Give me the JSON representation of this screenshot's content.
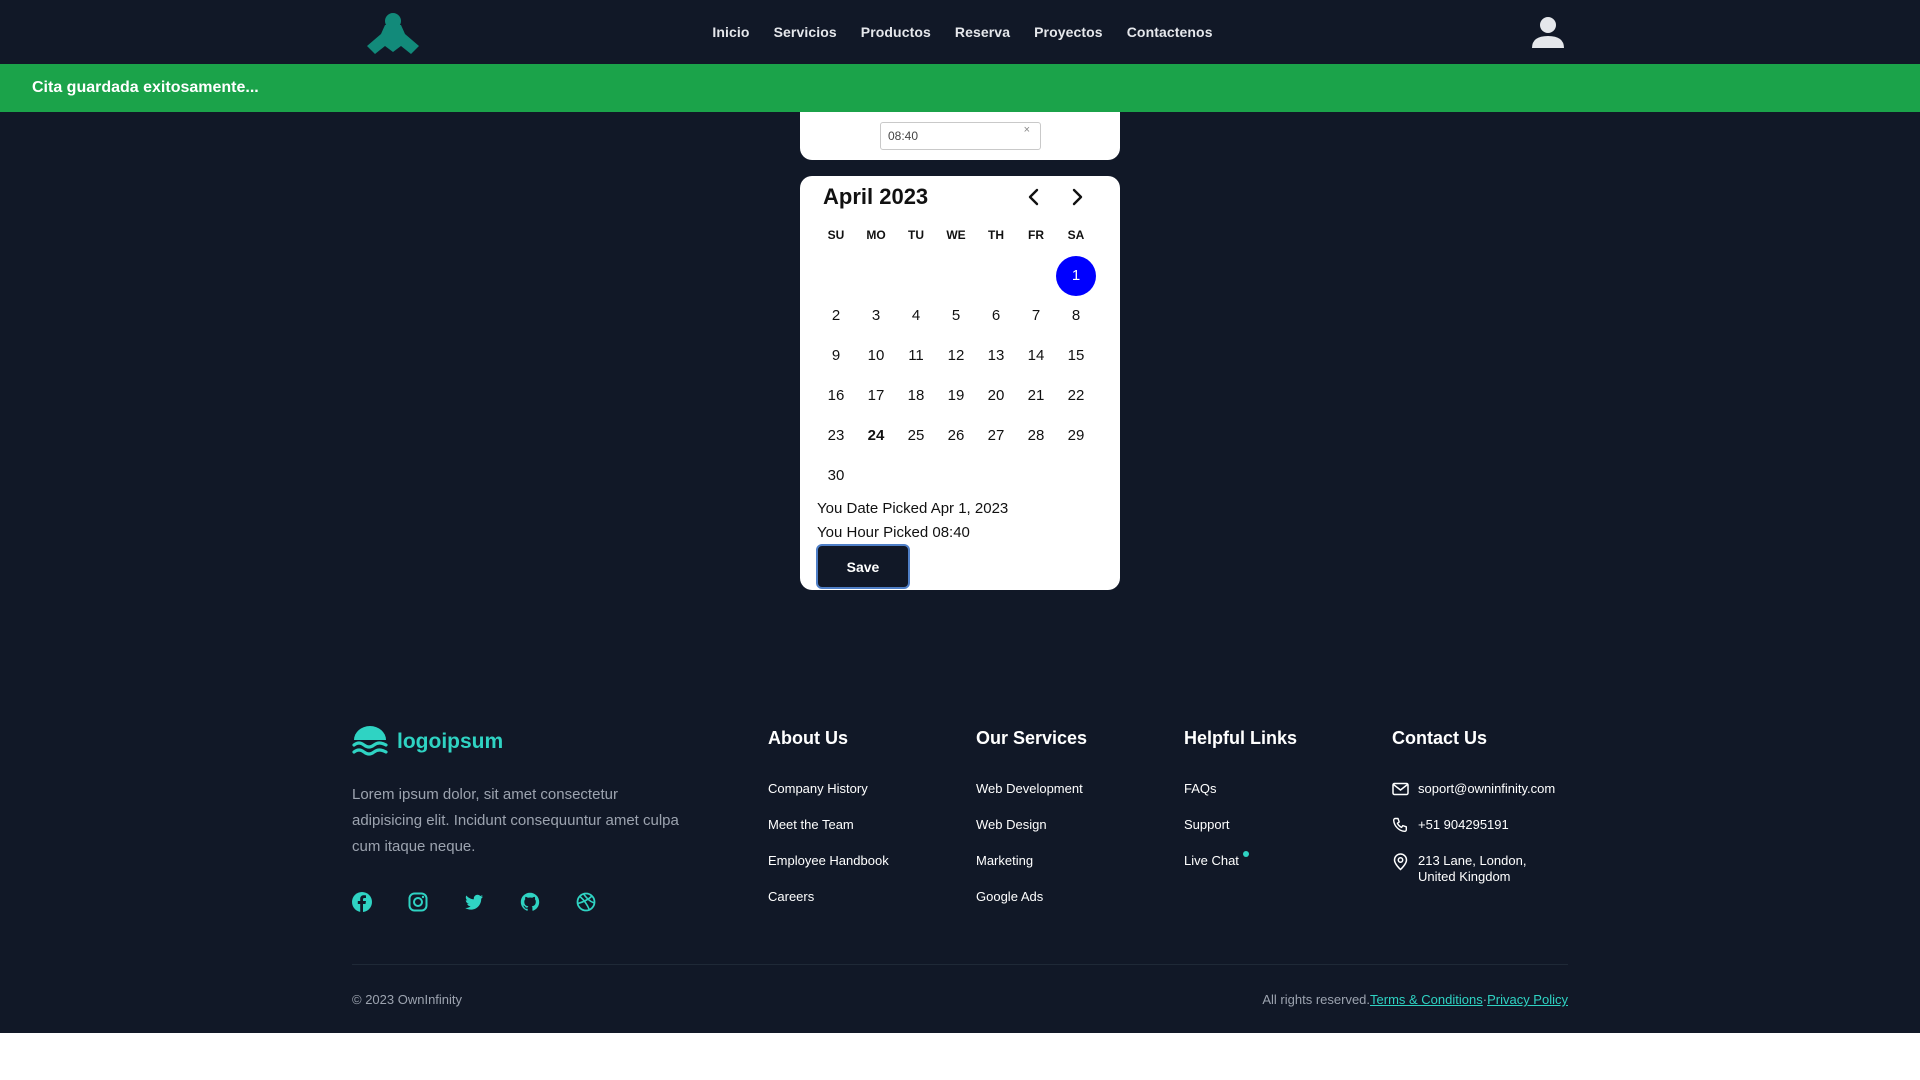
{
  "header": {
    "nav": [
      "Inicio",
      "Servicios",
      "Productos",
      "Reserva",
      "Proyectos",
      "Contactenos"
    ]
  },
  "toast": {
    "message": "Cita guardada exitosamente..."
  },
  "time_picker": {
    "value": "08:40",
    "clear_symbol": "×"
  },
  "calendar": {
    "month_label": "April 2023",
    "weekdays": [
      "SU",
      "MO",
      "TU",
      "WE",
      "TH",
      "FR",
      "SA"
    ],
    "days": [
      "1",
      "2",
      "3",
      "4",
      "5",
      "6",
      "7",
      "8",
      "9",
      "10",
      "11",
      "12",
      "13",
      "14",
      "15",
      "16",
      "17",
      "18",
      "19",
      "20",
      "21",
      "22",
      "23",
      "24",
      "25",
      "26",
      "27",
      "28",
      "29",
      "30"
    ],
    "selected_day": "1",
    "today_day": "24",
    "picked_date_text": "You Date Picked Apr 1, 2023",
    "picked_hour_text": "You Hour Picked 08:40",
    "save_label": "Save"
  },
  "footer": {
    "logo_text": "logoipsum",
    "description": "Lorem ipsum dolor, sit amet consectetur adipisicing elit. Incidunt consequuntur amet culpa cum itaque neque.",
    "socials": [
      "facebook-icon",
      "instagram-icon",
      "twitter-icon",
      "github-icon",
      "dribbble-icon"
    ],
    "about": {
      "title": "About Us",
      "links": [
        "Company History",
        "Meet the Team",
        "Employee Handbook",
        "Careers"
      ]
    },
    "services": {
      "title": "Our Services",
      "links": [
        "Web Development",
        "Web Design",
        "Marketing",
        "Google Ads"
      ]
    },
    "helpful": {
      "title": "Helpful Links",
      "links": [
        "FAQs",
        "Support",
        "Live Chat"
      ]
    },
    "contact": {
      "title": "Contact Us",
      "email": "soport@owninfinity.com",
      "phone": "+51 904295191",
      "address_line1": "213 Lane, London,",
      "address_line2": "United Kingdom"
    },
    "copyright": "© 2023 OwnInfinity",
    "rights": "All rights reserved.",
    "terms": "Terms & Conditions",
    "separator": "·",
    "privacy": "Privacy Policy"
  },
  "colors": {
    "page_bg": "#111827",
    "accent": "#2fd3c3",
    "toast_green": "#1ba34a",
    "selected_day": "#0000ff",
    "brand_teal": "#128a7a"
  }
}
